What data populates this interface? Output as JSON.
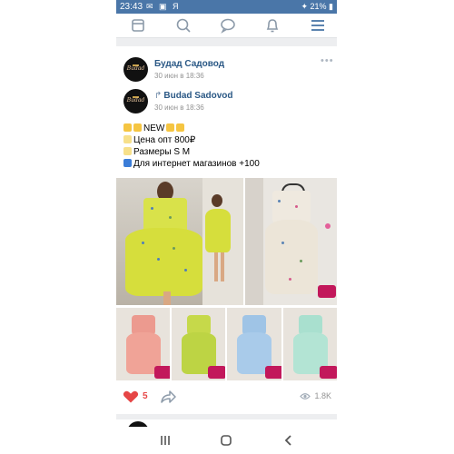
{
  "status_bar": {
    "time": "23:43",
    "left_icons": "✉ ▣ Я",
    "right_icons": "✦ 21% ▮"
  },
  "nav": {
    "icons": [
      "home-icon",
      "search-icon",
      "messages-icon",
      "notifications-icon",
      "menu-icon"
    ]
  },
  "post": {
    "author": {
      "name": "Будад Садовод",
      "date": "30 июн в 18:36",
      "avatar_text": "Budad"
    },
    "repost": {
      "name": "Budad Sadovod",
      "date": "30 июн в 18:36",
      "avatar_text": "Budad"
    },
    "more": "•••",
    "lines": [
      {
        "text": "NEW",
        "emoji_color": "#f5c542"
      },
      {
        "text": "Цена опт 800₽",
        "emoji_color": "#f7e08a"
      },
      {
        "text": "Размеры S M",
        "emoji_color": "#f7e08a"
      },
      {
        "text": "Для интернет магазинов +100",
        "emoji_color": "#3b7dd8"
      }
    ],
    "likes": "5",
    "views": "1.8K"
  },
  "colors": {
    "accent": "#4a76a8",
    "link": "#2a5885",
    "like": "#e64646",
    "muted": "#939393"
  }
}
